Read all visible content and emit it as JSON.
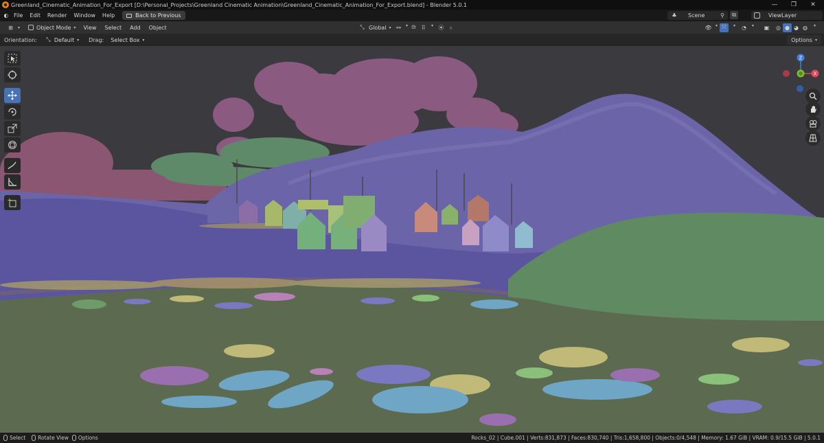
{
  "titlebar": {
    "title": "Greenland_Cinematic_Animation_For_Export [D:\\Personal_Projects\\Greenland Cinematic Animation\\Greenland_Cinematic_Animation_For_Export.blend] - Blender 5.0.1",
    "minimize": "—",
    "maximize": "❐",
    "close": "✕"
  },
  "menubar": {
    "items": [
      "File",
      "Edit",
      "Render",
      "Window",
      "Help"
    ],
    "back_button": "Back to Previous",
    "scene": "Scene",
    "view_layer": "ViewLayer"
  },
  "header": {
    "mode": "Object Mode",
    "menus": [
      "View",
      "Select",
      "Add",
      "Object"
    ],
    "transform_orientation": "Global"
  },
  "tool_settings": {
    "orientation_label": "Orientation:",
    "orientation_value": "Default",
    "drag_label": "Drag:",
    "drag_value": "Select Box",
    "options": "Options"
  },
  "gizmo": {
    "z": "Z",
    "x": "X",
    "y": "Y"
  },
  "statusbar": {
    "select": "Select",
    "rotate": "Rotate View",
    "options": "Options",
    "stats": "Rocks_02 | Cube.001 | Verts:831,873 | Faces:830,740 | Tris:1,658,800 | Objects:0/4,548 | Memory: 1.67 GiB | VRAM: 0.9/15.5 GiB | 5.0.1"
  },
  "colors": {
    "accent_active": "#4772b3",
    "axis_x": "#e0475a",
    "axis_y": "#7fbf2f",
    "axis_z": "#3f7fe0"
  }
}
